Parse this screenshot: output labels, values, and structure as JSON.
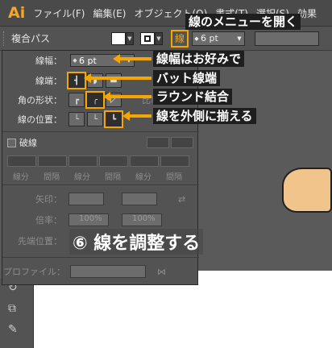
{
  "menubar": {
    "logo": "Ai",
    "items": [
      "ファイル(F)",
      "編集(E)",
      "オブジェクト(O)",
      "書式(T)",
      "選択(S)",
      "効果"
    ]
  },
  "control_bar": {
    "title": "複合パス",
    "stroke_icon": "線",
    "stroke_weight": "6 pt"
  },
  "stroke_panel": {
    "weight_label": "線幅：",
    "weight_value": "6 pt",
    "cap_label": "線端：",
    "corner_label": "角の形状：",
    "limit_label": "比率",
    "align_label": "線の位置：",
    "dashed_label": "破線",
    "dash_labels": [
      "線分",
      "間隔",
      "線分",
      "間隔",
      "線分",
      "間隔"
    ],
    "arrow_label": "矢印：",
    "scale_label": "倍率：",
    "scale_value_1": "100%",
    "scale_value_2": "100%",
    "align_arrow_label": "先端位置：",
    "profile_label": "プロファイル："
  },
  "callouts": {
    "open_menu": "線のメニューを開く",
    "weight": "線幅はお好みで",
    "butt_cap": "バット線端",
    "round_join": "ラウンド結合",
    "align_outside": "線を外側に揃える",
    "step_title": "⑥ 線を調整する"
  },
  "colors": {
    "highlight": "#f5a600",
    "panel": "#535353",
    "menubar": "#4a4a4a"
  }
}
